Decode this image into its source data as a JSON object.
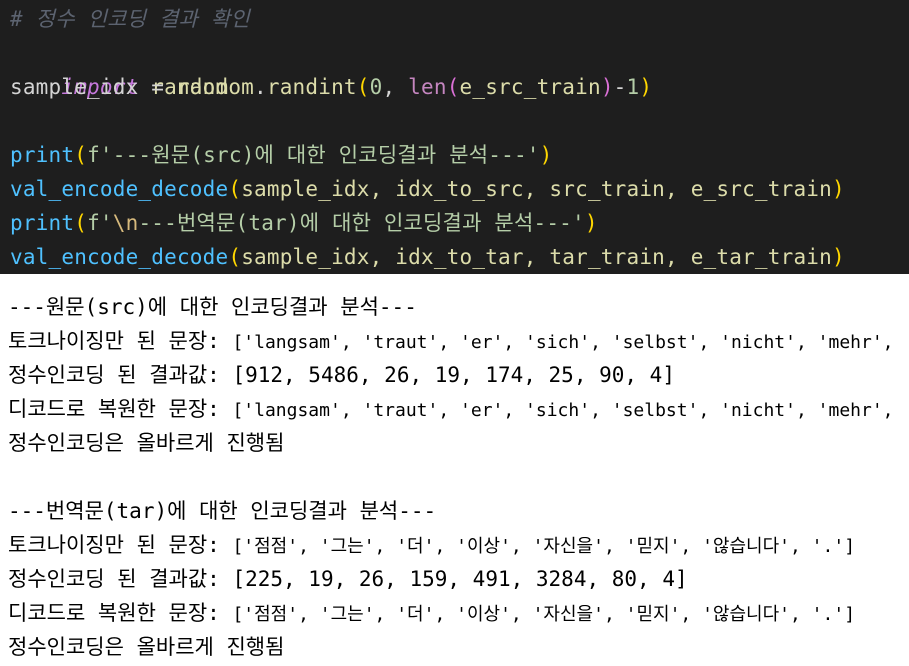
{
  "colors": {
    "background": "#1e1e1e",
    "comment": "#5c6370",
    "keyword": "#c678dd",
    "identifier": "#dcdcaa",
    "function": "#4fc1ff",
    "paren": "#ffd700",
    "string": "#ce9178",
    "number": "#b5cea8",
    "builtin": "#c586c0",
    "punct": "#d4d4d4"
  },
  "code": {
    "comment": "# 정수 인코딩 결과 확인",
    "import_kw": "import",
    "import_mod": "random",
    "l3": {
      "var": "sample_idx",
      "eq": " = ",
      "mod": "random",
      "dot": ".",
      "fn": "randint",
      "p1": "(",
      "zero": "0",
      "comma": ", ",
      "len": "len",
      "p2": "(",
      "arg": "e_src_train",
      "p3": ")",
      "minus": "-",
      "one": "1",
      "p4": ")"
    },
    "l5": {
      "fn": "print",
      "p1": "(",
      "str": "f'---원문(src)에 대한 인코딩결과 분석---'",
      "p2": ")"
    },
    "l6": {
      "fn": "val_encode_decode",
      "p1": "(",
      "args": "sample_idx, idx_to_src, src_train, e_src_train",
      "p2": ")"
    },
    "l7": {
      "fn": "print",
      "p1": "(",
      "str_pre": "f'",
      "escape": "\\n",
      "str_post": "---번역문(tar)에 대한 인코딩결과 분석---'",
      "p2": ")"
    },
    "l8": {
      "fn": "val_encode_decode",
      "p1": "(",
      "args": "sample_idx, idx_to_tar, tar_train, e_tar_train",
      "p2": ")"
    }
  },
  "output": {
    "src_header": "---원문(src)에 대한 인코딩결과 분석---",
    "src_tok_label": "토크나이징만 된 문장: ",
    "src_tok_value": "['langsam', 'traut', 'er', 'sich', 'selbst', 'nicht', 'mehr', '.']",
    "src_enc_label": "정수인코딩 된 결과값: ",
    "src_enc_value": "[912, 5486, 26, 19, 174, 25, 90, 4]",
    "src_dec_label": "디코드로 복원한 문장: ",
    "src_dec_value": "['langsam', 'traut', 'er', 'sich', 'selbst', 'nicht', 'mehr', '.']",
    "src_ok": "정수인코딩은 올바르게 진행됨",
    "tar_header": "---번역문(tar)에 대한 인코딩결과 분석---",
    "tar_tok_label": "토크나이징만 된 문장: ",
    "tar_tok_value": "['점점', '그는', '더', '이상', '자신을', '믿지', '않습니다', '.']",
    "tar_enc_label": "정수인코딩 된 결과값: ",
    "tar_enc_value": "[225, 19, 26, 159, 491, 3284, 80, 4]",
    "tar_dec_label": "디코드로 복원한 문장: ",
    "tar_dec_value": "['점점', '그는', '더', '이상', '자신을', '믿지', '않습니다', '.']",
    "tar_ok": "정수인코딩은 올바르게 진행됨"
  }
}
